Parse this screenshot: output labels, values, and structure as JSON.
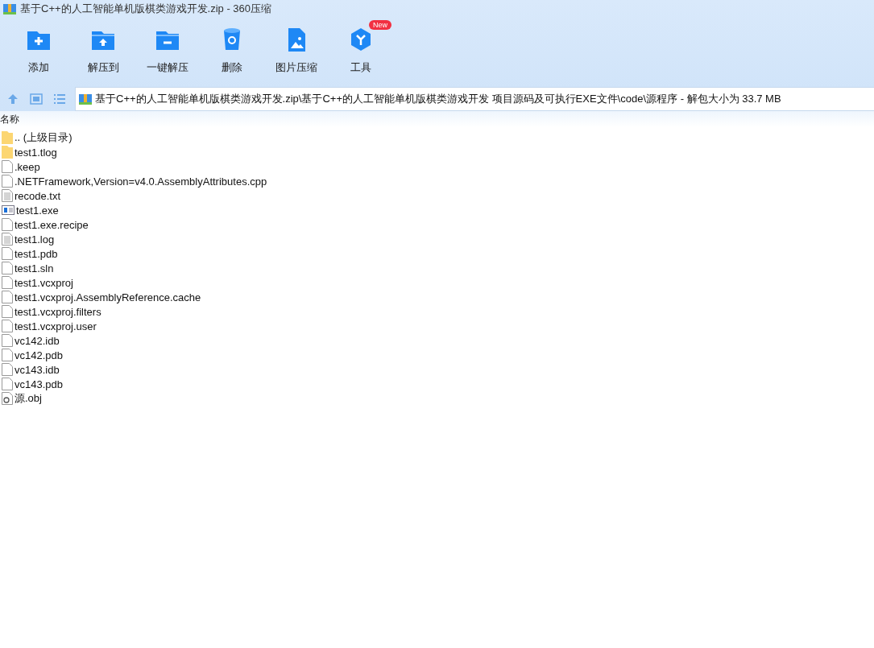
{
  "window": {
    "title": "基于C++的人工智能单机版棋类游戏开发.zip - 360压缩"
  },
  "toolbar": [
    {
      "kind": "add",
      "label": "添加"
    },
    {
      "kind": "extract",
      "label": "解压到"
    },
    {
      "kind": "oneclick",
      "label": "一键解压"
    },
    {
      "kind": "delete",
      "label": "删除"
    },
    {
      "kind": "image",
      "label": "图片压缩"
    },
    {
      "kind": "tools",
      "label": "工具",
      "badge": "New"
    }
  ],
  "address": {
    "path": "基于C++的人工智能单机版棋类游戏开发.zip\\基于C++的人工智能单机版棋类游戏开发 项目源码及可执行EXE文件\\code\\源程序 - 解包大小为 33.7 MB"
  },
  "table": {
    "columns": [
      "名称"
    ],
    "rows": [
      {
        "kind": "folder",
        "name": ".. (上级目录)"
      },
      {
        "kind": "folder",
        "name": "test1.tlog"
      },
      {
        "kind": "file",
        "name": ".keep"
      },
      {
        "kind": "file",
        "name": ".NETFramework,Version=v4.0.AssemblyAttributes.cpp"
      },
      {
        "kind": "text",
        "name": "recode.txt"
      },
      {
        "kind": "exe",
        "name": "test1.exe"
      },
      {
        "kind": "file",
        "name": "test1.exe.recipe"
      },
      {
        "kind": "text",
        "name": "test1.log"
      },
      {
        "kind": "file",
        "name": "test1.pdb"
      },
      {
        "kind": "file",
        "name": "test1.sln"
      },
      {
        "kind": "file",
        "name": "test1.vcxproj"
      },
      {
        "kind": "file",
        "name": "test1.vcxproj.AssemblyReference.cache"
      },
      {
        "kind": "file",
        "name": "test1.vcxproj.filters"
      },
      {
        "kind": "file",
        "name": "test1.vcxproj.user"
      },
      {
        "kind": "file",
        "name": "vc142.idb"
      },
      {
        "kind": "file",
        "name": "vc142.pdb"
      },
      {
        "kind": "file",
        "name": "vc143.idb"
      },
      {
        "kind": "file",
        "name": "vc143.pdb"
      },
      {
        "kind": "obj",
        "name": "源.obj"
      }
    ]
  }
}
